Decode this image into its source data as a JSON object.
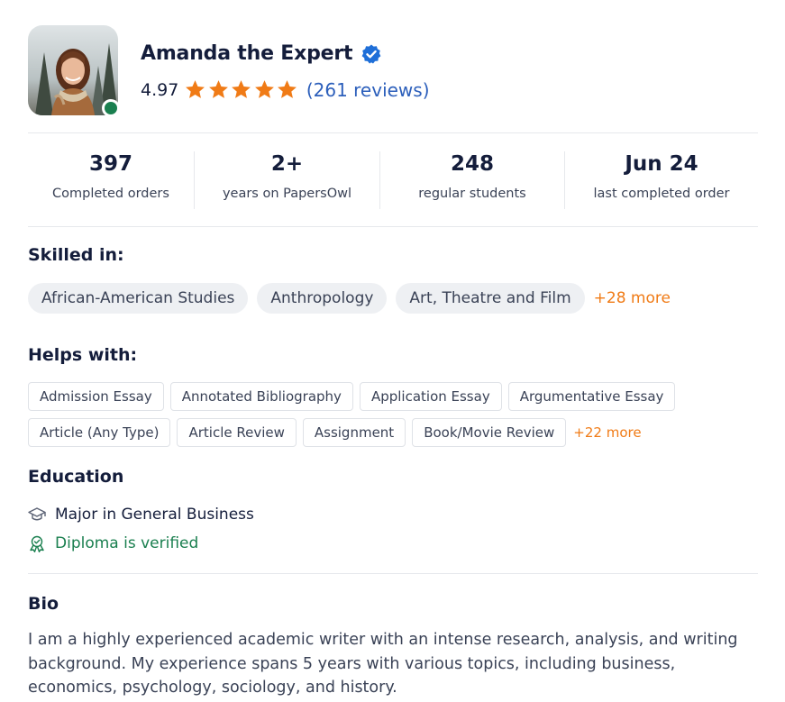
{
  "profile": {
    "name": "Amanda the Expert",
    "rating": "4.97",
    "stars_filled": 5,
    "reviews_label": "(261 reviews)",
    "online": true
  },
  "stats": [
    {
      "value": "397",
      "label": "Completed orders"
    },
    {
      "value": "2+",
      "label": "years on PapersOwl"
    },
    {
      "value": "248",
      "label": "regular students"
    },
    {
      "value": "Jun 24",
      "label": "last completed order"
    }
  ],
  "skills": {
    "title": "Skilled in:",
    "items": [
      "African-American Studies",
      "Anthropology",
      "Art, Theatre and Film"
    ],
    "more": "+28 more"
  },
  "helps": {
    "title": "Helps with:",
    "row1": [
      "Admission Essay",
      "Annotated Bibliography",
      "Application Essay",
      "Argumentative Essay"
    ],
    "row2": [
      "Article (Any Type)",
      "Article Review",
      "Assignment",
      "Book/Movie Review"
    ],
    "more": "+22 more"
  },
  "education": {
    "title": "Education",
    "major": "Major in General Business",
    "diploma": "Diploma is verified"
  },
  "bio": {
    "title": "Bio",
    "text": "I am a highly experienced academic writer with an intense research, analysis, and writing background. My experience spans 5 years with various topics, including business, economics, psychology, sociology, and history."
  },
  "colors": {
    "accent_orange": "#f07b16",
    "link_blue": "#2c5fbb",
    "verified_green": "#1a7f4f",
    "badge_blue": "#1f6fd8",
    "text_dark": "#141d3b"
  },
  "icons": {
    "verified": "verified-badge-icon",
    "star": "star-icon",
    "graduation": "graduation-cap-icon",
    "diploma": "certificate-ribbon-icon"
  }
}
